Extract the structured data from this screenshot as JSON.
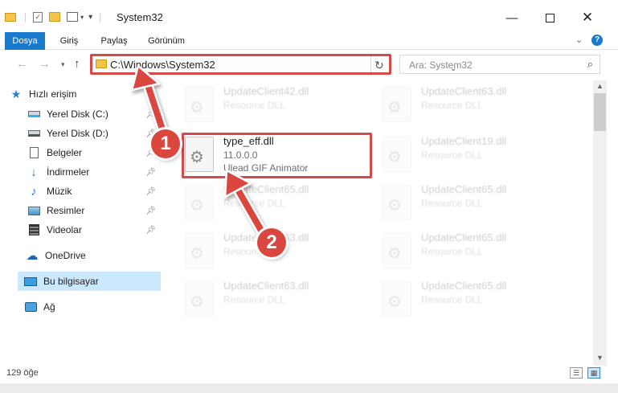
{
  "window": {
    "title": "System32",
    "minimize_icon": "minimize-icon",
    "maximize_icon": "maximize-icon",
    "close_icon": "close-icon"
  },
  "ribbon": {
    "tabs": [
      "Dosya",
      "Giriş",
      "Paylaş",
      "Görünüm"
    ],
    "accent": "#1979ca"
  },
  "address": {
    "path": "C:\\Windows\\System32",
    "search_placeholder": "Ara: System32"
  },
  "sidebar": {
    "items": [
      {
        "label": "Hızlı erişim",
        "icon": "star-icon"
      },
      {
        "label": "Yerel Disk (C:)",
        "icon": "drive-icon"
      },
      {
        "label": "Yerel Disk (D:)",
        "icon": "drive-icon"
      },
      {
        "label": "Belgeler",
        "icon": "documents-icon"
      },
      {
        "label": "İndirmeler",
        "icon": "download-icon"
      },
      {
        "label": "Müzik",
        "icon": "music-icon"
      },
      {
        "label": "Resimler",
        "icon": "pictures-icon"
      },
      {
        "label": "Videolar",
        "icon": "video-icon"
      },
      {
        "label": "OneDrive",
        "icon": "cloud-icon"
      },
      {
        "label": "Bu bilgisayar",
        "icon": "computer-icon"
      },
      {
        "label": "Ağ",
        "icon": "network-icon"
      }
    ]
  },
  "files": [
    {
      "name": "UpdateClient42.dll",
      "desc": "Resource DLL"
    },
    {
      "name": "UpdateClient63.dll",
      "desc": "Resource DLL"
    },
    {
      "name": "type_eff.dll",
      "version": "11.0.0.0",
      "desc": "Ulead GIF Animator"
    },
    {
      "name": "UpdateClient19.dll",
      "desc": "Resource DLL"
    },
    {
      "name": "UpdateClient65.dll",
      "desc": "Resource DLL"
    },
    {
      "name": "UpdateClient65.dll",
      "desc": "Resource DLL"
    },
    {
      "name": "UpdateClient63.dll",
      "desc": "Resource DLL"
    },
    {
      "name": "UpdateClient65.dll",
      "desc": "Resource DLL"
    },
    {
      "name": "UpdateClient63.dll",
      "desc": "Resource DLL"
    },
    {
      "name": "UpdateClient65.dll",
      "desc": "Resource DLL"
    }
  ],
  "status": {
    "count": "129 öğe"
  },
  "markers": [
    "1",
    "2"
  ],
  "highlight_color": "#d64a4a"
}
